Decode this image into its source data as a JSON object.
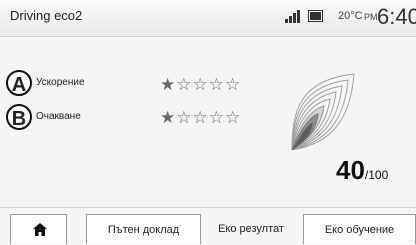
{
  "status_bar": {
    "app_title": "Driving eco2",
    "temperature": "20°C",
    "ampm": "PM",
    "time": "6:40"
  },
  "criteria": [
    {
      "letter": "A",
      "label": "Ускорение",
      "stars": "★☆☆☆☆",
      "rating": 1,
      "max": 5
    },
    {
      "letter": "B",
      "label": "Очакване",
      "stars": "★☆☆☆☆",
      "rating": 1,
      "max": 5
    }
  ],
  "score": {
    "value": "40",
    "max": "/100"
  },
  "tabs": [
    {
      "label": "",
      "icon": "home-icon"
    },
    {
      "label": "Пътен доклад"
    },
    {
      "label": "Еко резултат",
      "active": true
    },
    {
      "label": "Еко обучение"
    }
  ],
  "colors": {
    "leaf_stroke": "#9a9a9a",
    "leaf_fill": "#7a7a7a",
    "text": "#222222"
  }
}
